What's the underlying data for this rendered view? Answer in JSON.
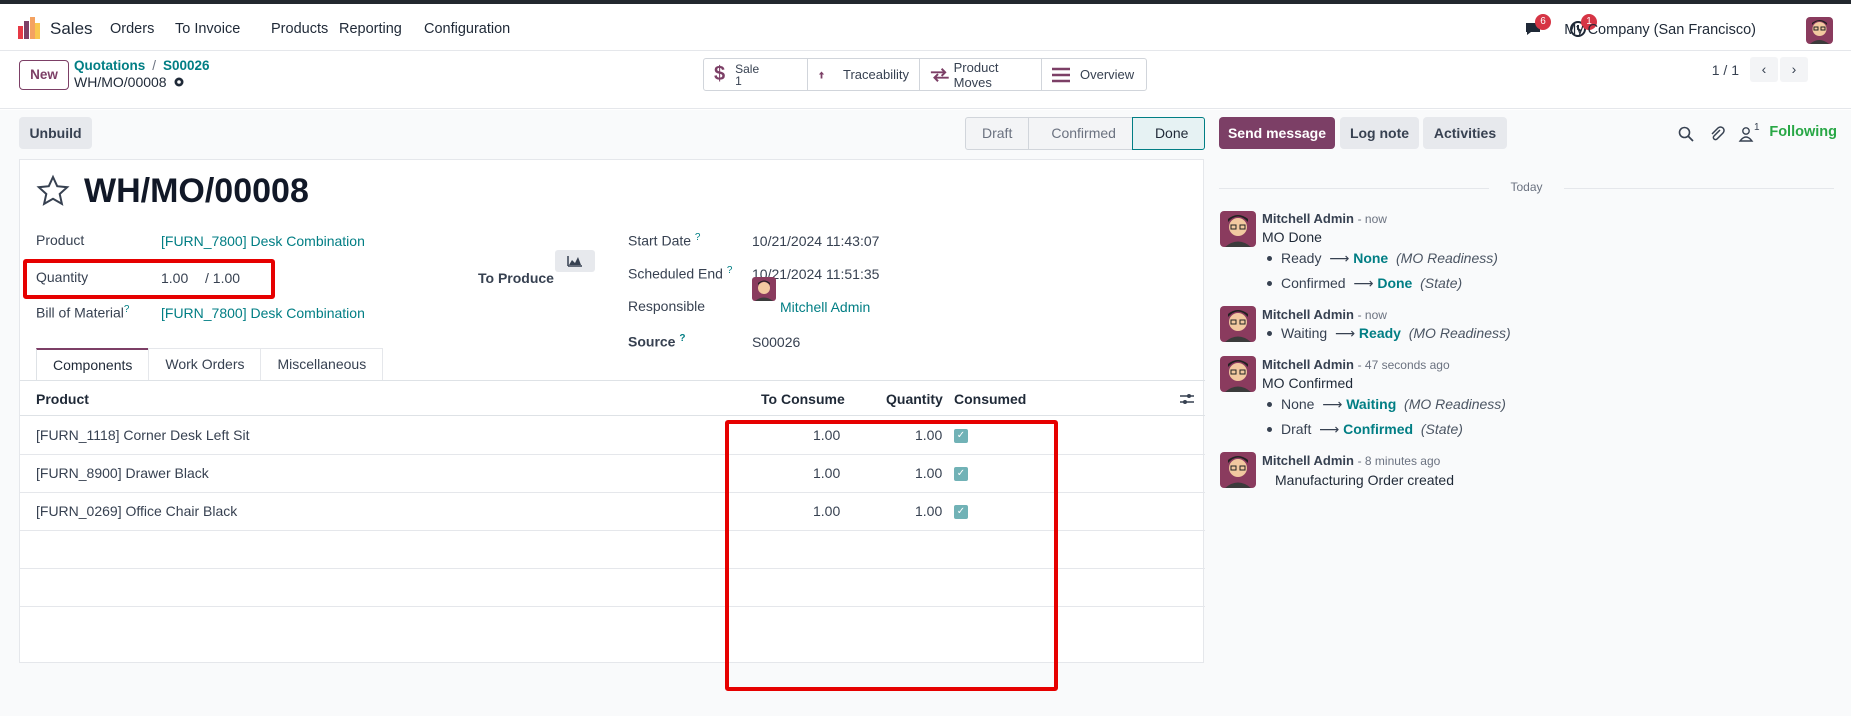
{
  "app": {
    "name": "Sales",
    "menu": [
      "Orders",
      "To Invoice",
      "Products",
      "Reporting",
      "Configuration"
    ]
  },
  "systray": {
    "messages_count": "6",
    "activities_count": "1",
    "company": "My Company (San Francisco)"
  },
  "control_panel": {
    "new_label": "New",
    "breadcrumb": [
      "Quotations",
      "S00026"
    ],
    "current": "WH/MO/00008",
    "smart_buttons": [
      {
        "label": "Sale",
        "value": "1",
        "icon": "dollar-icon"
      },
      {
        "label": "Traceability",
        "icon": "arrow-up-icon"
      },
      {
        "label": "Product Moves",
        "icon": "exchange-icon"
      },
      {
        "label": "Overview",
        "icon": "list-icon"
      }
    ],
    "pager": "1 / 1"
  },
  "form": {
    "unbuild_label": "Unbuild",
    "statusbar": [
      "Draft",
      "Confirmed",
      "Done"
    ],
    "active_status": "Done",
    "title": "WH/MO/00008",
    "fields": {
      "product_label": "Product",
      "product_value": "[FURN_7800] Desk Combination",
      "quantity_label": "Quantity",
      "quantity_value": "1.00",
      "quantity_total": "/ 1.00",
      "to_produce_label": "To Produce",
      "bom_label": "Bill of Material",
      "bom_value": "[FURN_7800] Desk Combination",
      "start_label": "Start Date",
      "start_value": "10/21/2024 11:43:07",
      "end_label": "Scheduled End",
      "end_value": "10/21/2024 11:51:35",
      "resp_label": "Responsible",
      "resp_value": "Mitchell Admin",
      "source_label": "Source",
      "source_value": "S00026"
    },
    "tabs": [
      "Components",
      "Work Orders",
      "Miscellaneous"
    ],
    "table": {
      "headers": [
        "Product",
        "To Consume",
        "Quantity",
        "Consumed"
      ],
      "rows": [
        {
          "product": "[FURN_1118] Corner Desk Left Sit",
          "to_consume": "1.00",
          "quantity": "1.00",
          "consumed": true
        },
        {
          "product": "[FURN_8900] Drawer Black",
          "to_consume": "1.00",
          "quantity": "1.00",
          "consumed": true
        },
        {
          "product": "[FURN_0269] Office Chair Black",
          "to_consume": "1.00",
          "quantity": "1.00",
          "consumed": true
        }
      ]
    }
  },
  "chatter": {
    "send_message": "Send message",
    "log_note": "Log note",
    "activities": "Activities",
    "followers_count": "1",
    "following": "Following",
    "date_sep": "Today",
    "messages": [
      {
        "author": "Mitchell Admin",
        "time": "- now",
        "text": "MO Done",
        "tracking": [
          {
            "old": "Ready",
            "new": "None",
            "field": "(MO Readiness)"
          },
          {
            "old": "Confirmed",
            "new": "Done",
            "field": "(State)"
          }
        ]
      },
      {
        "author": "Mitchell Admin",
        "time": "- now",
        "text": "",
        "tracking": [
          {
            "old": "Waiting",
            "new": "Ready",
            "field": "(MO Readiness)"
          }
        ]
      },
      {
        "author": "Mitchell Admin",
        "time": "- 47 seconds ago",
        "text": "MO Confirmed",
        "tracking": [
          {
            "old": "None",
            "new": "Waiting",
            "field": "(MO Readiness)"
          },
          {
            "old": "Draft",
            "new": "Confirmed",
            "field": "(State)"
          }
        ]
      },
      {
        "author": "Mitchell Admin",
        "time": "- 8 minutes ago",
        "text": "Manufacturing Order created",
        "tracking": []
      }
    ]
  },
  "colors": {
    "brand": "#7c3f66",
    "link": "#017e84",
    "highlight": "#e60000",
    "following": "#28a745"
  }
}
